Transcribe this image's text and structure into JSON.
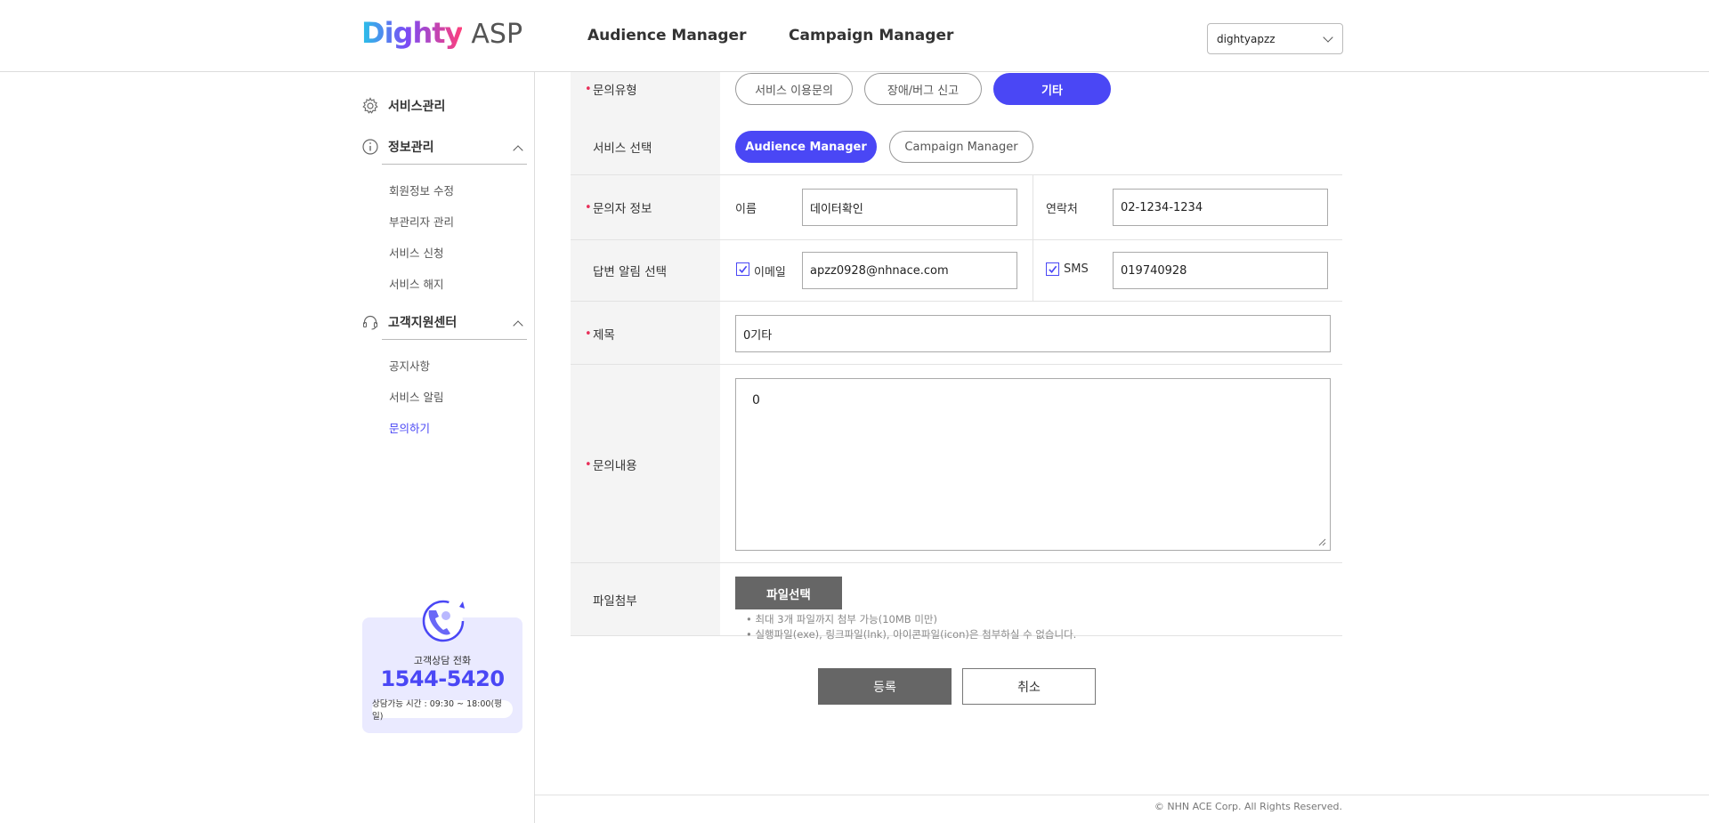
{
  "header": {
    "logo_brand": "Dighty",
    "logo_product": "ASP",
    "nav": [
      "Audience Manager",
      "Campaign Manager"
    ],
    "account_selected": "dightyapzz"
  },
  "sidebar": {
    "groups": [
      {
        "label": "서비스관리",
        "icon": "gear-icon"
      },
      {
        "label": "정보관리",
        "icon": "info-icon",
        "expanded": true,
        "items": [
          "회원정보 수정",
          "부관리자 관리",
          "서비스 신청",
          "서비스 해지"
        ]
      },
      {
        "label": "고객지원센터",
        "icon": "headset-icon",
        "expanded": true,
        "items": [
          "공지사항",
          "서비스 알림",
          "문의하기"
        ],
        "active_item": "문의하기"
      }
    ],
    "support": {
      "label": "고객상담 전화",
      "phone": "1544-5420",
      "hours": "상담가능 시간 : 09:30 ~ 18:00(평일)"
    }
  },
  "form": {
    "inquiry_type": {
      "label": "문의유형",
      "required": true,
      "options": [
        "서비스 이용문의",
        "장애/버그 신고",
        "기타"
      ],
      "selected": "기타"
    },
    "service": {
      "label": "서비스 선택",
      "options": [
        "Audience Manager",
        "Campaign Manager"
      ],
      "selected": "Audience Manager"
    },
    "inquirer": {
      "label": "문의자 정보",
      "required": true,
      "name_label": "이름",
      "name_value": "데이터확인",
      "contact_label": "연락처",
      "contact_value": "02-1234-1234"
    },
    "notify": {
      "label": "답변 알림 선택",
      "email_label": "이메일",
      "email_checked": true,
      "email_value": "apzz0928@nhnace.com",
      "sms_label": "SMS",
      "sms_checked": true,
      "sms_value": "019740928"
    },
    "subject": {
      "label": "제목",
      "required": true,
      "value": "0기타"
    },
    "content": {
      "label": "문의내용",
      "required": true,
      "value": "0"
    },
    "attachment": {
      "label": "파일첨부",
      "button": "파일선택",
      "notes": [
        "• 최대 3개 파일까지 첨부 가능(10MB 미만)",
        "• 실행파일(exe), 링크파일(lnk), 아이콘파일(icon)은 첨부하실 수 없습니다."
      ]
    },
    "submit_label": "등록",
    "cancel_label": "취소"
  },
  "footer": {
    "copyright": "© NHN ACE Corp. All Rights Reserved."
  },
  "colors": {
    "accent": "#4a47f5",
    "required": "#e8305a",
    "button_dark": "#666666"
  }
}
